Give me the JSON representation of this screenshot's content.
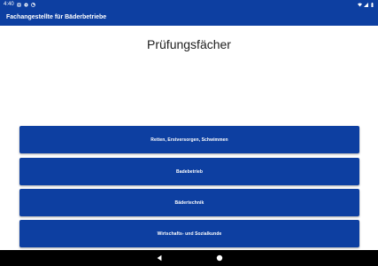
{
  "status_bar": {
    "time": "4:40"
  },
  "app_bar": {
    "title": "Fachangestellte für Bäderbetriebe"
  },
  "main": {
    "title": "Prüfungsfächer",
    "subjects": [
      {
        "label": "Retten, Erstversorgen, Schwimmen"
      },
      {
        "label": "Badebetrieb"
      },
      {
        "label": "Bädertechnik"
      },
      {
        "label": "Wirtschafts- und Sozialkunde"
      }
    ]
  },
  "colors": {
    "primary": "#0d3fa1",
    "nav": "#000000",
    "background": "#ffffff"
  },
  "icons": [
    "sim-icon",
    "settings-icon",
    "data-saver-icon",
    "wifi-icon",
    "signal-icon",
    "battery-icon",
    "back-icon",
    "home-icon"
  ]
}
